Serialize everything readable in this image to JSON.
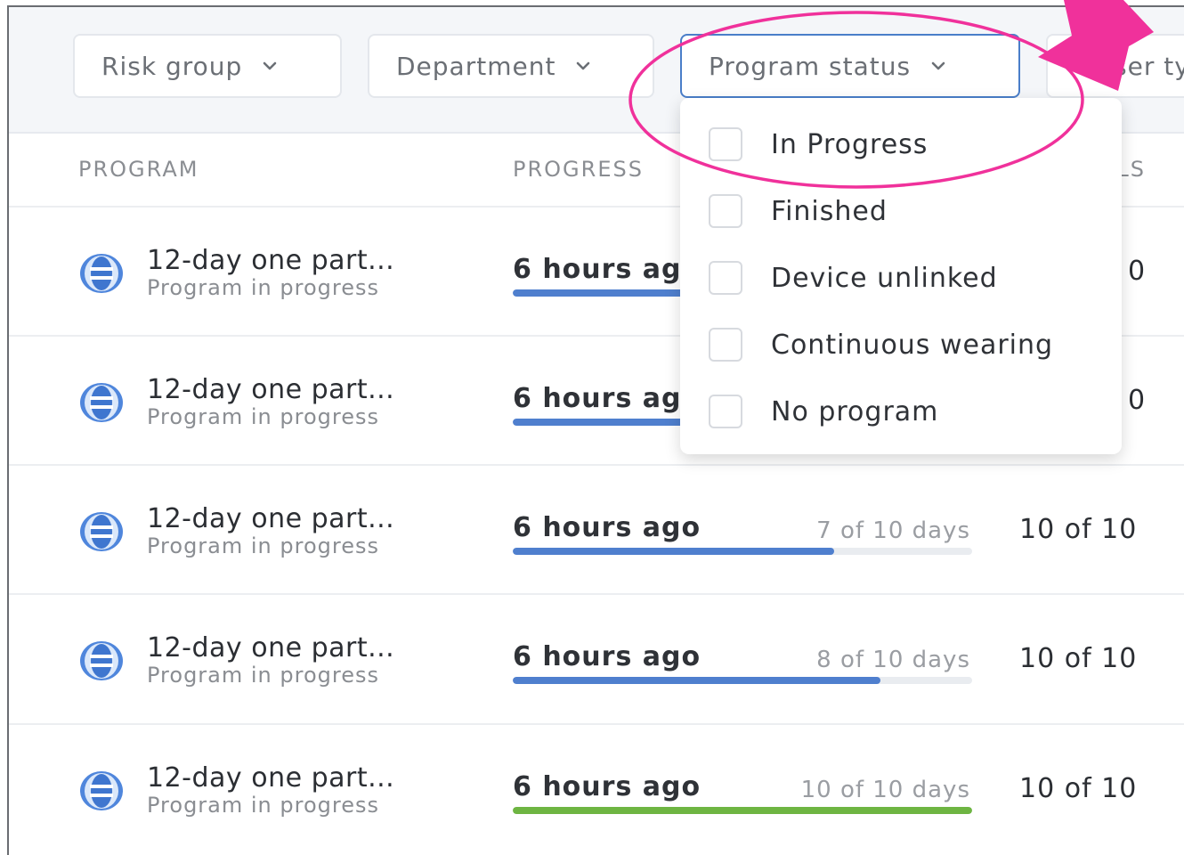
{
  "filters": {
    "risk_group": "Risk group",
    "department": "Department",
    "program_status": "Program status",
    "user_type_partial": "ser ty"
  },
  "table": {
    "headers": {
      "program": "PROGRAM",
      "progress": "PROGRESS",
      "goals_partial": "ALS"
    },
    "rows": [
      {
        "title": "12-day one part...",
        "subtitle": "Program in progress",
        "ago": "6 hours ag",
        "days": "",
        "progress": 0.7,
        "goals": "0",
        "fill_color": "#4f7fce"
      },
      {
        "title": "12-day one part...",
        "subtitle": "Program in progress",
        "ago": "6 hours ag",
        "days": "",
        "progress": 0.7,
        "goals": "0",
        "fill_color": "#4f7fce"
      },
      {
        "title": "12-day one part...",
        "subtitle": "Program in progress",
        "ago": "6 hours ago",
        "days": "7 of 10 days",
        "progress": 0.7,
        "goals": "10 of 10",
        "fill_color": "#4f7fce"
      },
      {
        "title": "12-day one part...",
        "subtitle": "Program in progress",
        "ago": "6 hours ago",
        "days": "8 of 10 days",
        "progress": 0.8,
        "goals": "10 of 10",
        "fill_color": "#4f7fce"
      },
      {
        "title": "12-day one part...",
        "subtitle": "Program in progress",
        "ago": "6 hours ago",
        "days": "10 of 10 days",
        "progress": 1.0,
        "goals": "10 of 10",
        "fill_color": "#6eb542"
      }
    ]
  },
  "dropdown": {
    "options": [
      {
        "label": "In Progress",
        "checked": false
      },
      {
        "label": "Finished",
        "checked": false
      },
      {
        "label": "Device unlinked",
        "checked": false
      },
      {
        "label": "Continuous wearing",
        "checked": false
      },
      {
        "label": "No program",
        "checked": false
      }
    ]
  },
  "colors": {
    "accent": "#4a7ec9",
    "progress_fill": "#4f7fce",
    "progress_complete": "#6eb542",
    "annotation": "#f0319b"
  }
}
